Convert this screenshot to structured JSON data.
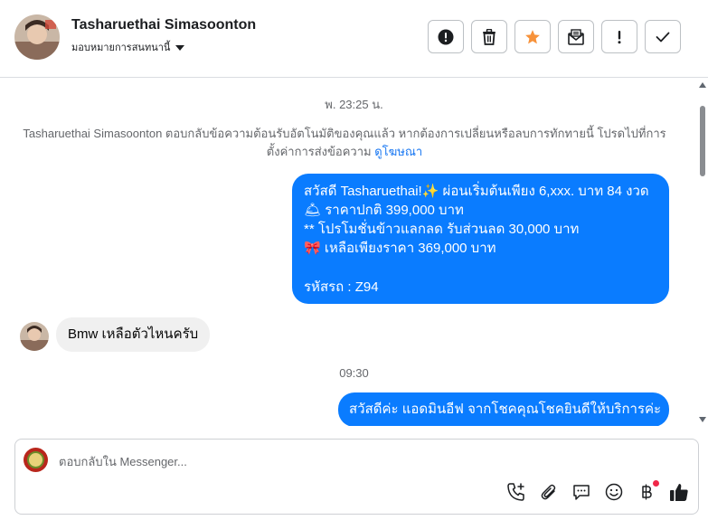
{
  "header": {
    "contact_name": "Tasharuethai Simasoonton",
    "assign_label": "มอบหมายการสนทนานี้",
    "tools": [
      {
        "name": "report-button",
        "icon": "alert-circle-icon"
      },
      {
        "name": "delete-button",
        "icon": "trash-icon"
      },
      {
        "name": "star-button",
        "icon": "star-icon",
        "color": "#f7923a"
      },
      {
        "name": "mark-unread-button",
        "icon": "envelope-icon"
      },
      {
        "name": "follow-up-button",
        "icon": "exclamation-icon"
      },
      {
        "name": "mark-done-button",
        "icon": "check-icon"
      }
    ]
  },
  "conversation": {
    "timestamp_1": "พ. 23:25 น.",
    "system_note": "Tasharuethai Simasoonton ตอบกลับข้อความต้อนรับอัตโนมัติของคุณแล้ว หากต้องการเปลี่ยนหรือลบการทักทายนี้ โปรดไปที่การตั้งค่าการส่งข้อความ",
    "system_note_link": "ดูโฆษณา",
    "outgoing_1": {
      "lines": [
        "สวัสดี Tasharuethai!✨  ผ่อนเริ่มต้นเพียง 6,xxx. บาท 84 งวด",
        "🛎 ราคาปกติ 399,000 บาท",
        "** โปรโมชั่นข้าวแลกลด รับส่วนลด 30,000 บาท",
        "🎀  เหลือเพียงราคา 369,000 บาท",
        "",
        "รหัสรถ : Z94"
      ]
    },
    "incoming_1": "Bmw เหลือตัวไหนครับ",
    "timestamp_2": "09:30",
    "outgoing_2": "สวัสดีค่ะ แอดมินอีฟ จากโชคคุณโชคยินดีให้บริการค่ะ"
  },
  "composer": {
    "placeholder": "ตอบกลับใน Messenger...",
    "value": "",
    "icons": [
      "phone-add-icon",
      "paperclip-icon",
      "chat-bubble-icon",
      "emoji-icon",
      "baht-icon",
      "thumbs-up-icon"
    ]
  },
  "colors": {
    "accent": "#0a7cff",
    "link": "#1877f2",
    "incoming_bubble": "#f0f0f0",
    "star": "#f7923a",
    "notification_dot": "#f02849"
  }
}
